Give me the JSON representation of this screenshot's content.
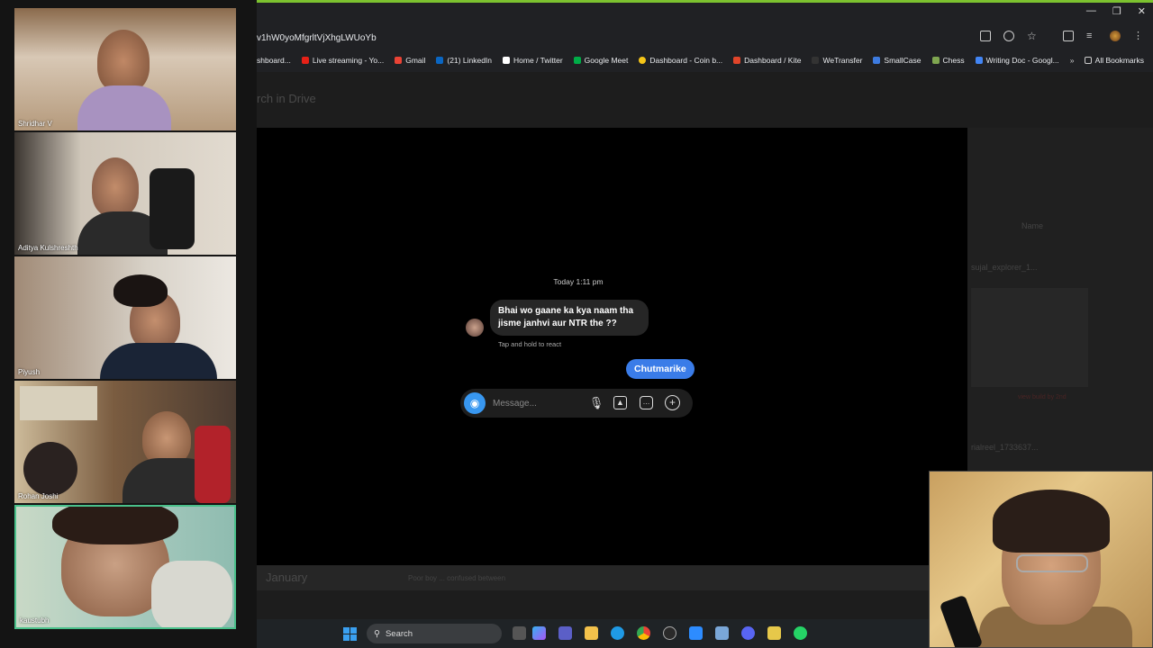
{
  "participants": [
    {
      "name": "Shridhar V",
      "bg": "#b79b7c",
      "shirt": "#9f86b8"
    },
    {
      "name": "Aditya Kulshreshth",
      "bg": "#c9c1b6",
      "shirt": "#2a2a2a"
    },
    {
      "name": "Piyush",
      "bg": "#a69381",
      "shirt": "#1a2436"
    },
    {
      "name": "Rohan Joshi",
      "bg": "#6e5640",
      "shirt": "#2b2b2b"
    },
    {
      "name": "kaustubh",
      "bg": "#aac9bc",
      "shirt": "#d8d8d0"
    }
  ],
  "chrome": {
    "address": "v1hW0yoMfgrltVjXhgLWUoYb",
    "bookmarks": [
      {
        "label": "shboard...",
        "color": "#666"
      },
      {
        "label": "Live streaming - Yo...",
        "color": "#e62117"
      },
      {
        "label": "Gmail",
        "color": "#ea4335"
      },
      {
        "label": "(21) LinkedIn",
        "color": "#0a66c2"
      },
      {
        "label": "Home / Twitter",
        "color": "#ffffff"
      },
      {
        "label": "Google Meet",
        "color": "#00ac47"
      },
      {
        "label": "Dashboard - Coin b...",
        "color": "#f5c518"
      },
      {
        "label": "Dashboard / Kite",
        "color": "#e0452a"
      },
      {
        "label": "WeTransfer",
        "color": "#333"
      },
      {
        "label": "SmallCase",
        "color": "#3d7be0"
      },
      {
        "label": "Chess",
        "color": "#7fa650"
      },
      {
        "label": "Writing Doc - Googl...",
        "color": "#4285f4"
      }
    ],
    "more": "»",
    "all_bookmarks": "All Bookmarks"
  },
  "drive": {
    "search_placeholder": "rch in Drive",
    "name_col": "Name",
    "file1": "sujal_explorer_1...",
    "file2": "rialreel_1733637...",
    "view_hint": "view build by 2nd",
    "bottom_month": "January",
    "bottom_caption": "Poor boy ... confused between"
  },
  "chat": {
    "time": "Today 1:11 pm",
    "incoming": "Bhai wo gaane ka kya naam tha jisme janhvi aur NTR the ??",
    "react_hint": "Tap and hold to react",
    "outgoing": "Chutmarike",
    "placeholder": "Message..."
  },
  "taskbar": {
    "search": "Search"
  }
}
